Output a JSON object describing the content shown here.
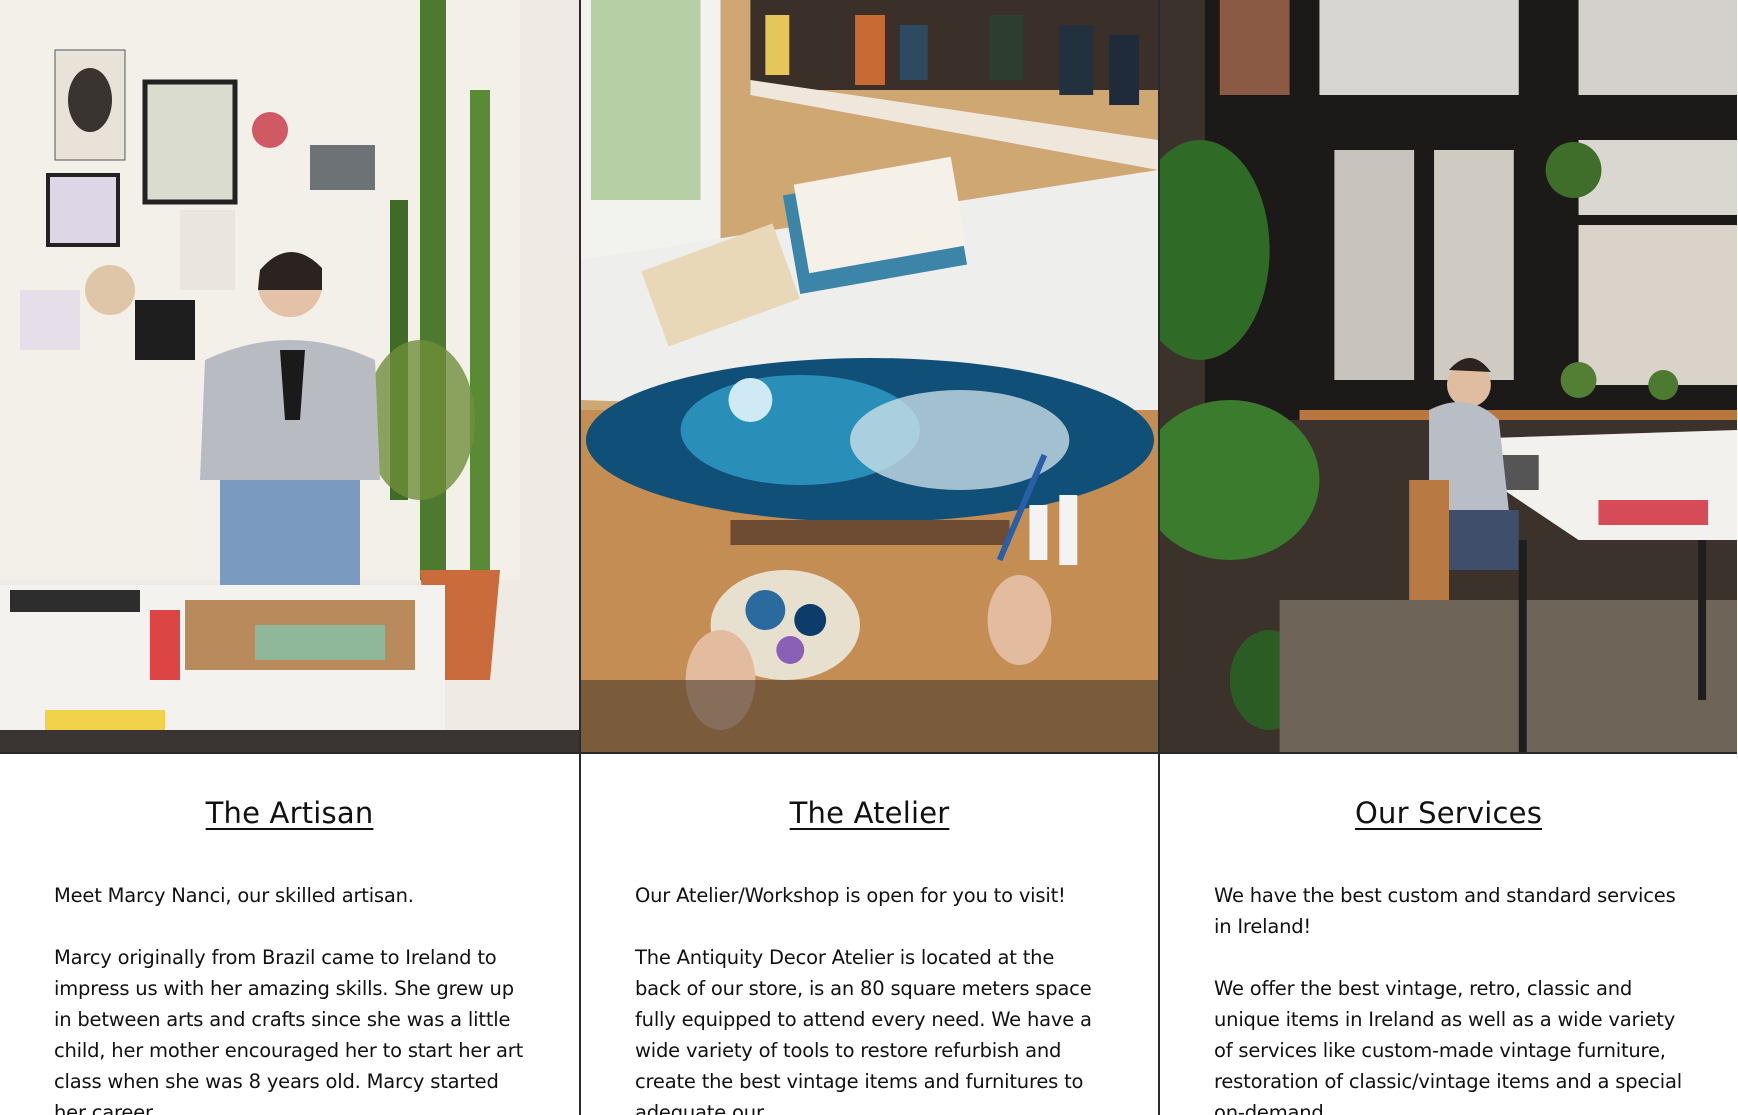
{
  "columns": [
    {
      "title": "The Artisan",
      "paragraphs": [
        "Meet Marcy Nanci, our skilled artisan.",
        "Marcy originally from Brazil came to Ireland to impress us with her amazing skills. She grew up in between arts and crafts since she was a little child, her mother encouraged her to start her art class when she was 8 years old. Marcy started her career"
      ]
    },
    {
      "title": "The Atelier",
      "paragraphs": [
        "Our Atelier/Workshop is open for you to visit!",
        "The Antiquity Decor Atelier is located at the back of our store, is an 80 square meters space fully equipped to attend every need. We have a wide variety of tools to restore refurbish and create the best vintage items and furnitures to adequate our"
      ]
    },
    {
      "title": "Our Services",
      "paragraphs": [
        "We have the best custom and standard services in Ireland!",
        "We offer the best vintage, retro, classic and unique items in Ireland as well as a wide variety of services like custom-made vintage furniture, restoration of classic/vintage items and a special on-demand"
      ]
    }
  ]
}
